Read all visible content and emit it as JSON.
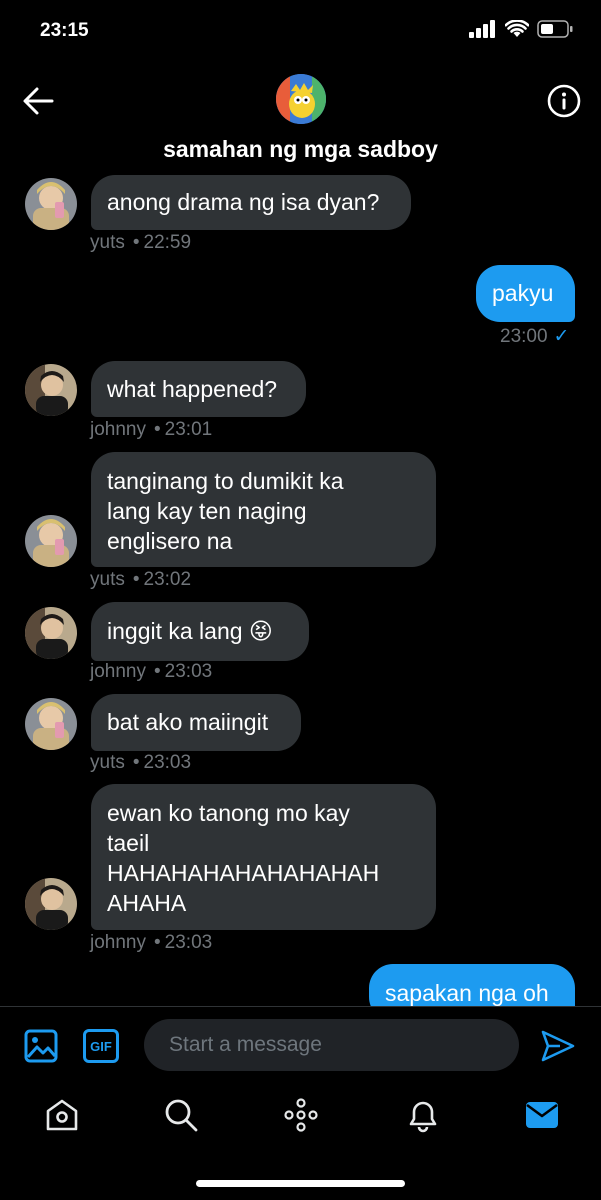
{
  "status": {
    "time": "23:15"
  },
  "header": {
    "group_name": "samahan ng mga sadboy",
    "group_avatar": "simpsons-character-avatar"
  },
  "messages": [
    {
      "sender": "yuts",
      "direction": "in",
      "text": "anong drama ng isa dyan?",
      "time": "22:59"
    },
    {
      "sender": "me",
      "direction": "out",
      "text": "pakyu",
      "time": "23:00"
    },
    {
      "sender": "johnny",
      "direction": "in",
      "text": "what happened?",
      "time": "23:01"
    },
    {
      "sender": "yuts",
      "direction": "in",
      "lines": [
        "tanginang to dumikit ka",
        "lang kay ten naging",
        "englisero na"
      ],
      "time": "23:02"
    },
    {
      "sender": "johnny",
      "direction": "in",
      "text": "inggit ka lang 😝",
      "time": "23:03"
    },
    {
      "sender": "yuts",
      "direction": "in",
      "text": "bat ako maiingit",
      "time": "23:03"
    },
    {
      "sender": "johnny",
      "direction": "in",
      "lines": [
        "ewan ko tanong mo kay",
        "taeil",
        "HAHAHAHAHAHAHAHAH",
        "AHAHA"
      ],
      "time": "23:03"
    },
    {
      "sender": "me",
      "direction": "out",
      "text": "sapakan nga oh"
    }
  ],
  "composer": {
    "placeholder": "Start a message",
    "gif_label": "GIF"
  },
  "tabs": [
    "home-icon",
    "search-icon",
    "spaces-icon",
    "notifications-icon",
    "messages-icon"
  ],
  "colors": {
    "accent": "#1d9bf0",
    "incoming_bubble": "#2f3336",
    "background": "#000000",
    "meta_text": "#71767b"
  }
}
